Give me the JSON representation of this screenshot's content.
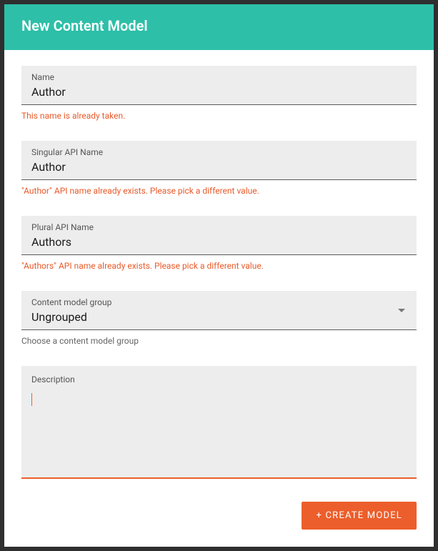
{
  "header": {
    "title": "New Content Model"
  },
  "fields": {
    "name": {
      "label": "Name",
      "value": "Author",
      "error": "This name is already taken."
    },
    "singularApi": {
      "label": "Singular API Name",
      "value": "Author",
      "error": "\"Author\" API name already exists. Please pick a different value."
    },
    "pluralApi": {
      "label": "Plural API Name",
      "value": "Authors",
      "error": "\"Authors\" API name already exists. Please pick a different value."
    },
    "group": {
      "label": "Content model group",
      "value": "Ungrouped",
      "helper": "Choose a content model group"
    },
    "description": {
      "label": "Description",
      "value": ""
    }
  },
  "footer": {
    "createButton": "+ CREATE MODEL"
  }
}
